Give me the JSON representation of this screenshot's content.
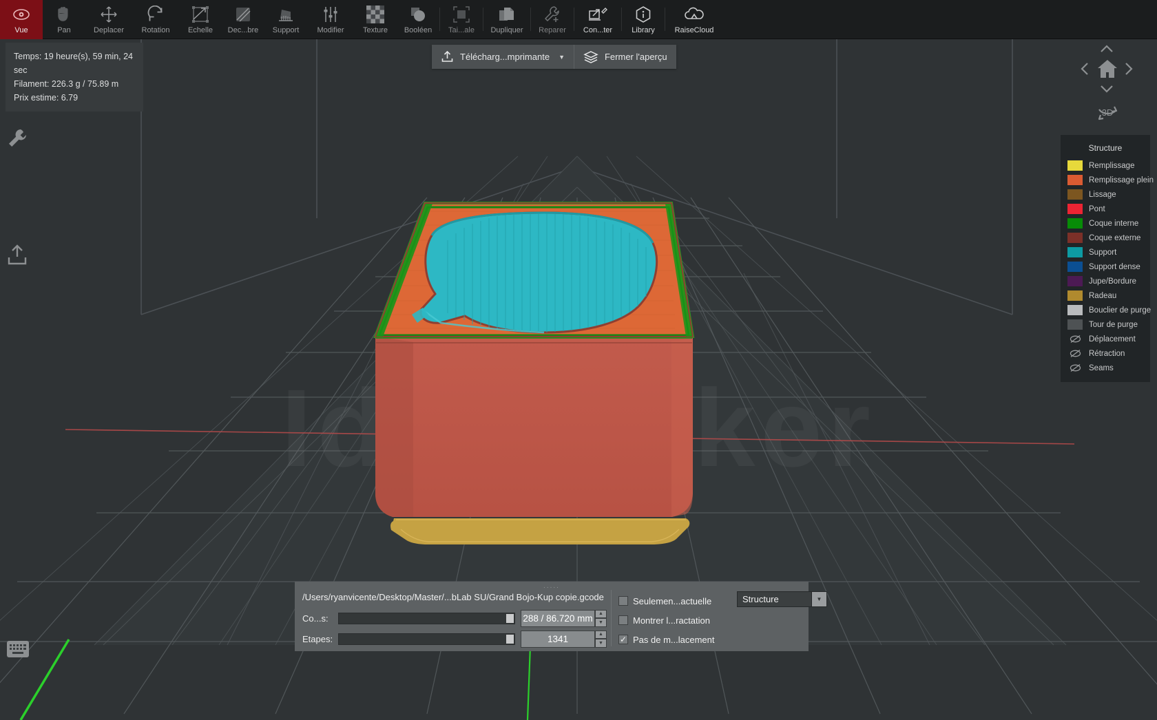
{
  "toolbar": {
    "items": [
      {
        "label": "Vue",
        "icon": "eye-icon",
        "state": "active"
      },
      {
        "label": "Pan",
        "icon": "hand-icon",
        "state": "normal"
      },
      {
        "label": "Deplacer",
        "icon": "move-arrows-icon",
        "state": "normal"
      },
      {
        "label": "Rotation",
        "icon": "rotate-icon",
        "state": "normal"
      },
      {
        "label": "Echelle",
        "icon": "scale-icon",
        "state": "normal"
      },
      {
        "label": "Dec...bre",
        "icon": "cut-icon",
        "state": "normal"
      },
      {
        "label": "Support",
        "icon": "support-icon",
        "state": "normal"
      },
      {
        "label": "Modifier",
        "icon": "sliders-icon",
        "state": "normal"
      },
      {
        "label": "Texture",
        "icon": "checker-icon",
        "state": "normal"
      },
      {
        "label": "Booléen",
        "icon": "boolean-icon",
        "state": "normal"
      },
      {
        "label": "Tai...ale",
        "icon": "fit-size-icon",
        "state": "dim"
      },
      {
        "label": "Dupliquer",
        "icon": "duplicate-icon",
        "state": "normal"
      },
      {
        "label": "Reparer",
        "icon": "wrench-plus-icon",
        "state": "dim"
      },
      {
        "label": "Con...ter",
        "icon": "connect-device-icon",
        "state": "bright"
      },
      {
        "label": "Library",
        "icon": "info-hex-icon",
        "state": "bright"
      },
      {
        "label": "RaiseCloud",
        "icon": "cloud-icon",
        "state": "bright"
      }
    ]
  },
  "info_panel": {
    "time": "Temps: 19 heure(s), 59 min, 24 sec",
    "filament": "Filament: 226.3 g / 75.89 m",
    "price": "Prix estime: 6.79"
  },
  "center_bar": {
    "upload_label": "Télécharg...mprimante",
    "upload_icon": "upload-icon",
    "caret": "▼",
    "close_preview_label": "Fermer l'aperçu",
    "close_preview_icon": "layers-icon"
  },
  "nav_widget": {
    "up": "⌃",
    "down": "⌄",
    "left": "‹",
    "right": "›",
    "home_icon": "home-icon",
    "rotate3d_label": "3D"
  },
  "left_icons": [
    {
      "name": "wrench-icon"
    },
    {
      "name": "upload-icon"
    },
    {
      "name": "keyboard-icon"
    }
  ],
  "legend": {
    "title": "Structure",
    "items": [
      {
        "label": "Remplissage",
        "color": "#e7d93b",
        "type": "swatch"
      },
      {
        "label": "Remplissage plein",
        "color": "#da5b32",
        "type": "swatch"
      },
      {
        "label": "Lissage",
        "color": "#7c5620",
        "type": "swatch"
      },
      {
        "label": "Pont",
        "color": "#ec2433",
        "type": "swatch"
      },
      {
        "label": "Coque interne",
        "color": "#078c07",
        "type": "swatch"
      },
      {
        "label": "Coque externe",
        "color": "#7c3028",
        "type": "swatch"
      },
      {
        "label": "Support",
        "color": "#0d9ba3",
        "type": "swatch"
      },
      {
        "label": "Support dense",
        "color": "#0b4f93",
        "type": "swatch"
      },
      {
        "label": "Jupe/Bordure",
        "color": "#4c1a54",
        "type": "swatch"
      },
      {
        "label": "Radeau",
        "color": "#b08a2e",
        "type": "swatch"
      },
      {
        "label": "Bouclier de purge",
        "color": "#b9bbbd",
        "type": "swatch"
      },
      {
        "label": "Tour de purge",
        "color": "#4e5254",
        "type": "swatch"
      },
      {
        "label": "Déplacement",
        "color": "",
        "type": "eye-off"
      },
      {
        "label": "Rétraction",
        "color": "",
        "type": "eye-off"
      },
      {
        "label": "Seams",
        "color": "",
        "type": "eye-off"
      }
    ]
  },
  "bottom_panel": {
    "grip": ".....",
    "file_path": "/Users/ryanvicente/Desktop/Master/...bLab SU/Grand Bojo-Kup copie.gcode",
    "layers_label": "Co...s:",
    "layers_value": "288 / 86.720 mm",
    "steps_label": "Etapes:",
    "steps_value": "1341",
    "spin_up": "▲",
    "spin_down": "▼",
    "checkboxes": [
      {
        "label": "Seulemen...actuelle",
        "checked": false
      },
      {
        "label": "Montrer l...ractation",
        "checked": false
      },
      {
        "label": "Pas de m...lacement",
        "checked": true
      }
    ],
    "check_glyph": "✓",
    "select_value": "Structure",
    "select_arrow": "▼"
  },
  "viewport": {
    "watermark": "Ideamaker"
  },
  "colors": {
    "accent_red": "#7c0f16",
    "toolbar_bg": "#1b1d1e",
    "viewport_bg": "#2f3335",
    "panel_bg": "#5d6163",
    "legend_bg": "#212527"
  }
}
